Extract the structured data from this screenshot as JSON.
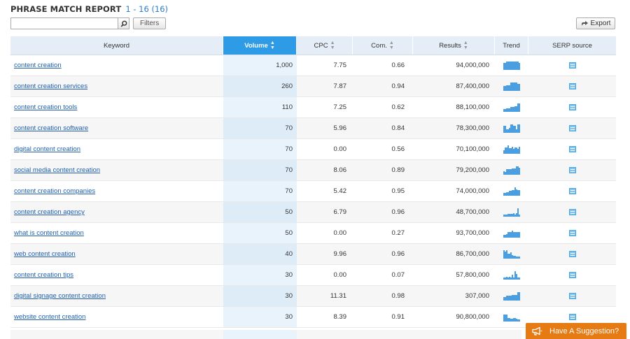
{
  "header": {
    "title": "PHRASE MATCH REPORT",
    "range": "1 - 16 (16)"
  },
  "search": {
    "value": "",
    "placeholder": ""
  },
  "toolbar": {
    "filters_label": "Filters",
    "export_label": "Export"
  },
  "columns": [
    {
      "key": "keyword",
      "label": "Keyword",
      "sortable": false
    },
    {
      "key": "volume",
      "label": "Volume",
      "sortable": true,
      "active": true
    },
    {
      "key": "cpc",
      "label": "CPC",
      "sortable": true
    },
    {
      "key": "com",
      "label": "Com.",
      "sortable": true
    },
    {
      "key": "results",
      "label": "Results",
      "sortable": true
    },
    {
      "key": "trend",
      "label": "Trend",
      "sortable": false
    },
    {
      "key": "serp",
      "label": "SERP source",
      "sortable": false
    }
  ],
  "rows": [
    {
      "keyword": "content creation",
      "volume": "1,000",
      "cpc": "7.75",
      "com": "0.66",
      "results": "94,000,000",
      "trend": [
        0.8,
        0.8,
        0.9,
        0.9,
        0.9,
        0.9,
        0.9,
        0.9,
        0.9,
        0.9,
        0.9,
        0.8
      ]
    },
    {
      "keyword": "content creation services",
      "volume": "260",
      "cpc": "7.87",
      "com": "0.94",
      "results": "87,400,000",
      "trend": [
        0.5,
        0.5,
        0.6,
        0.6,
        0.6,
        0.9,
        0.9,
        0.9,
        0.9,
        0.9,
        0.8,
        0.8
      ]
    },
    {
      "keyword": "content creation tools",
      "volume": "110",
      "cpc": "7.25",
      "com": "0.62",
      "results": "88,100,000",
      "trend": [
        0.3,
        0.3,
        0.4,
        0.4,
        0.4,
        0.5,
        0.5,
        0.5,
        0.6,
        0.6,
        0.9,
        0.9
      ]
    },
    {
      "keyword": "content creation software",
      "volume": "70",
      "cpc": "5.96",
      "com": "0.84",
      "results": "78,300,000",
      "trend": [
        0.8,
        0.8,
        0.4,
        0.4,
        0.5,
        0.9,
        0.9,
        0.8,
        0.8,
        0.4,
        0.9,
        0.9
      ]
    },
    {
      "keyword": "digital content creation",
      "volume": "70",
      "cpc": "0.00",
      "com": "0.56",
      "results": "70,100,000",
      "trend": [
        0.4,
        0.7,
        0.7,
        0.9,
        0.6,
        0.6,
        0.8,
        0.5,
        0.7,
        0.7,
        0.5,
        0.8
      ]
    },
    {
      "keyword": "social media content creation",
      "volume": "70",
      "cpc": "8.06",
      "com": "0.89",
      "results": "79,200,000",
      "trend": [
        0.4,
        0.3,
        0.6,
        0.6,
        0.6,
        0.6,
        0.7,
        0.7,
        0.7,
        0.9,
        0.9,
        0.8
      ]
    },
    {
      "keyword": "content creation companies",
      "volume": "70",
      "cpc": "5.42",
      "com": "0.95",
      "results": "74,000,000",
      "trend": [
        0.3,
        0.3,
        0.4,
        0.4,
        0.5,
        0.5,
        0.6,
        0.6,
        0.9,
        0.7,
        0.6,
        0.6
      ]
    },
    {
      "keyword": "content creation agency",
      "volume": "50",
      "cpc": "6.79",
      "com": "0.96",
      "results": "48,700,000",
      "trend": [
        0.2,
        0.2,
        0.2,
        0.3,
        0.3,
        0.3,
        0.3,
        0.4,
        0.2,
        0.4,
        0.9,
        0.2
      ]
    },
    {
      "keyword": "what is content creation",
      "volume": "50",
      "cpc": "0.00",
      "com": "0.27",
      "results": "93,700,000",
      "trend": [
        0.3,
        0.3,
        0.4,
        0.6,
        0.6,
        0.6,
        0.8,
        0.6,
        0.6,
        0.6,
        0.6,
        0.6
      ]
    },
    {
      "keyword": "web content creation",
      "volume": "40",
      "cpc": "9.96",
      "com": "0.96",
      "results": "86,700,000",
      "trend": [
        0.9,
        0.8,
        0.9,
        0.5,
        0.5,
        0.7,
        0.4,
        0.3,
        0.3,
        0.2,
        0.2,
        0.2
      ]
    },
    {
      "keyword": "content creation tips",
      "volume": "30",
      "cpc": "0.00",
      "com": "0.07",
      "results": "57,800,000",
      "trend": [
        0.2,
        0.2,
        0.3,
        0.2,
        0.3,
        0.2,
        0.5,
        0.2,
        0.9,
        0.6,
        0.2,
        0.2
      ]
    },
    {
      "keyword": "digital signage content creation",
      "volume": "30",
      "cpc": "11.31",
      "com": "0.98",
      "results": "307,000",
      "trend": [
        0.4,
        0.4,
        0.5,
        0.5,
        0.5,
        0.5,
        0.6,
        0.6,
        0.6,
        0.6,
        0.9,
        0.9
      ]
    },
    {
      "keyword": "website content creation",
      "volume": "30",
      "cpc": "8.39",
      "com": "0.91",
      "results": "90,800,000",
      "trend": [
        0.8,
        0.8,
        0.8,
        0.4,
        0.4,
        0.3,
        0.3,
        0.4,
        0.4,
        0.3,
        0.2,
        0.2
      ]
    }
  ],
  "suggestion": {
    "label": "Have A Suggestion?"
  },
  "icons": {
    "search": "search-icon",
    "export": "export-arrow-icon",
    "serp": "serp-document-icon",
    "megaphone": "megaphone-icon"
  },
  "colors": {
    "accent": "#2d9be6",
    "link": "#1f5fae",
    "range": "#2a7ec8",
    "trend": "#4b9fe0",
    "suggest": "#e67a13"
  }
}
